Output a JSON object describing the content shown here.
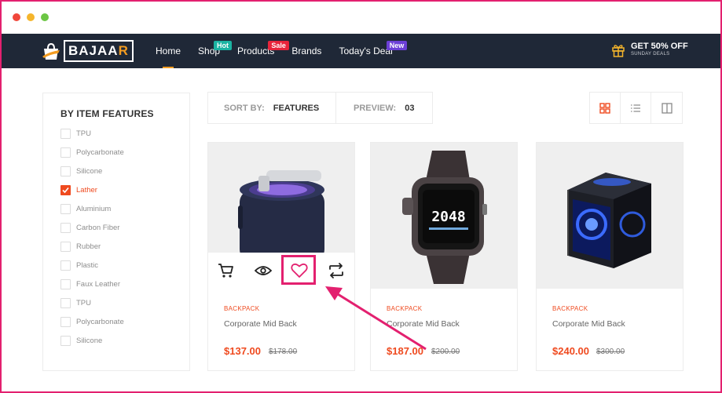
{
  "window": {
    "dots": [
      "close",
      "minimize",
      "maximize"
    ]
  },
  "header": {
    "logo_text": "BAJAAR",
    "menu": [
      {
        "label": "Home",
        "active": true
      },
      {
        "label": "Shop",
        "badge": "Hot"
      },
      {
        "label": "Products",
        "badge": "Sale"
      },
      {
        "label": "Brands"
      },
      {
        "label": "Today's Deal",
        "badge": "New"
      }
    ],
    "promo_title": "GET 50% OFF",
    "promo_sub": "SUNDAY DEALS"
  },
  "sidebar": {
    "title": "BY ITEM FEATURES",
    "features": [
      {
        "label": "TPU",
        "checked": false
      },
      {
        "label": "Polycarbonate",
        "checked": false
      },
      {
        "label": "Silicone",
        "checked": false
      },
      {
        "label": "Lather",
        "checked": true
      },
      {
        "label": "Aluminium",
        "checked": false
      },
      {
        "label": "Carbon Fiber",
        "checked": false
      },
      {
        "label": "Rubber",
        "checked": false
      },
      {
        "label": "Plastic",
        "checked": false
      },
      {
        "label": "Faux Leather",
        "checked": false
      },
      {
        "label": "TPU",
        "checked": false
      },
      {
        "label": "Polycarbonate",
        "checked": false
      },
      {
        "label": "Silicone",
        "checked": false
      }
    ]
  },
  "toolbar": {
    "sort_label": "SORT BY:",
    "sort_value": "FEATURES",
    "preview_label": "PREVIEW:",
    "preview_value": "03",
    "views": [
      "grid-view-icon",
      "list-view-icon",
      "column-view-icon"
    ]
  },
  "products": [
    {
      "category": "BACKPACK",
      "name": "Corporate Mid Back",
      "price": "$137.00",
      "old_price": "$178.00",
      "image": "mosquito-lamp"
    },
    {
      "category": "BACKPACK",
      "name": "Corporate Mid Back",
      "price": "$187.00",
      "old_price": "$200.00",
      "image": "smartwatch"
    },
    {
      "category": "BACKPACK",
      "name": "Corporate Mid Back",
      "price": "$240.00",
      "old_price": "$300.00",
      "image": "pc-case"
    }
  ],
  "watch_time": "2048",
  "colors": {
    "accent": "#ef4a1f",
    "nav": "#1f2837",
    "highlight": "#e3206f"
  }
}
